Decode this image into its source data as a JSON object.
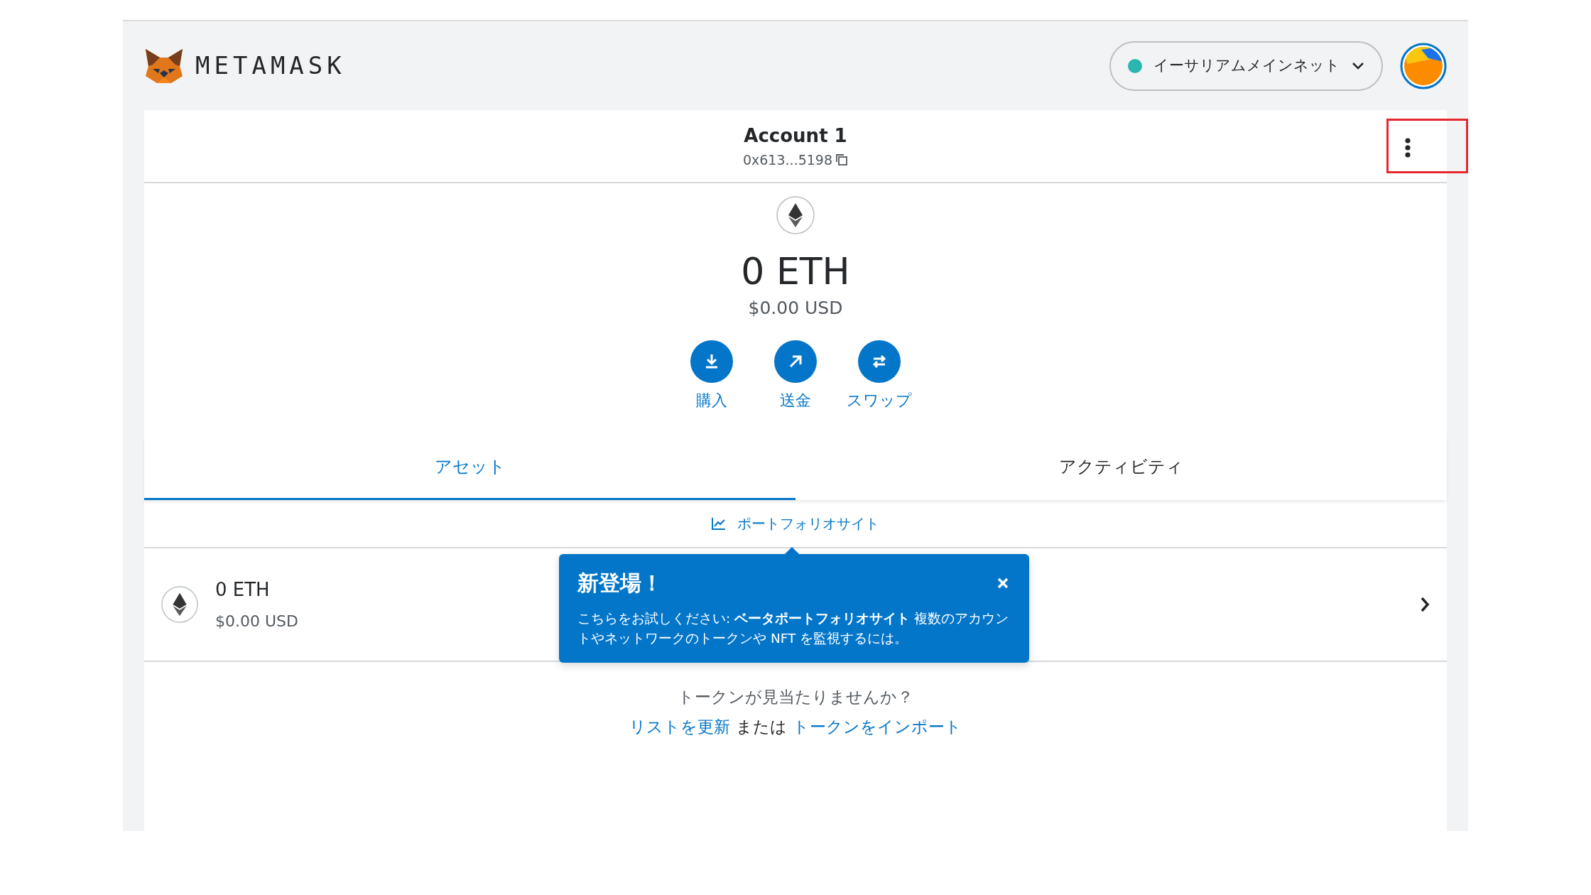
{
  "header": {
    "logo_text": "METAMASK",
    "network": "イーサリアムメインネット"
  },
  "account": {
    "name": "Account 1",
    "address": "0x613...5198",
    "menu_highlighted": true
  },
  "balance": {
    "amount": "0 ETH",
    "fiat": "$0.00 USD"
  },
  "actions": [
    {
      "kind": "buy",
      "label": "購入"
    },
    {
      "kind": "send",
      "label": "送金"
    },
    {
      "kind": "swap",
      "label": "スワップ"
    }
  ],
  "tabs": [
    {
      "label": "アセット",
      "selected": true
    },
    {
      "label": "アクティビティ",
      "selected": false
    }
  ],
  "portfolio_link": "ポートフォリオサイト",
  "assets": [
    {
      "amount": "0 ETH",
      "fiat": "$0.00 USD"
    }
  ],
  "popover": {
    "title": "新登場！",
    "body": "こちらをお試しください: **ベータポートフォリオサイト** 複数のアカウントやネットワークのトークンや NFT を監視するには。"
  },
  "footer": {
    "question": "トークンが見当たりませんか？",
    "refresh_link": "リストを更新",
    "or": "または",
    "import_link": "トークンをインポート"
  }
}
